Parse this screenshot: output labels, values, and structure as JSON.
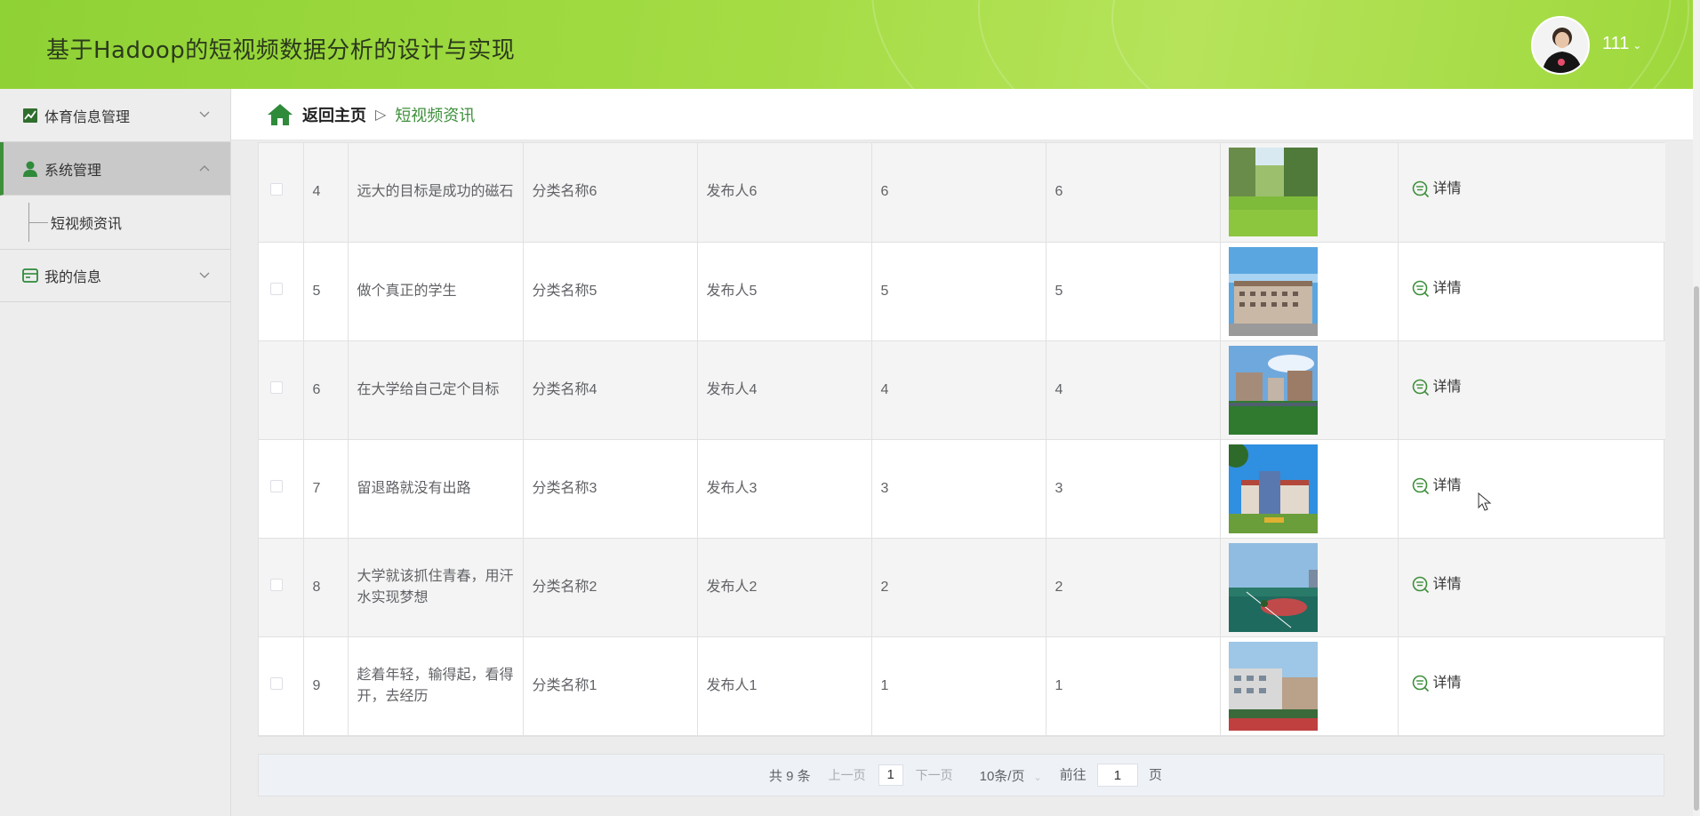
{
  "header": {
    "title": "基于Hadoop的短视频数据分析的设计与实现",
    "user": "111"
  },
  "sidebar": {
    "items": [
      {
        "label": "体育信息管理",
        "icon": "chart-icon"
      },
      {
        "label": "系统管理",
        "icon": "user-icon",
        "active": true,
        "children": [
          {
            "label": "短视频资讯"
          }
        ]
      },
      {
        "label": "我的信息",
        "icon": "card-icon"
      }
    ]
  },
  "breadcrumb": {
    "home": "返回主页",
    "separator": "▷",
    "current": "短视频资讯"
  },
  "table": {
    "detail_label": "详情",
    "rows": [
      {
        "index": "4",
        "title": "远大的目标是成功的磁石",
        "category": "分类名称6",
        "publisher": "发布人6",
        "col5": "6",
        "col6": "6",
        "image": "grass-park"
      },
      {
        "index": "5",
        "title": "做个真正的学生",
        "category": "分类名称5",
        "publisher": "发布人5",
        "col5": "5",
        "col6": "5",
        "image": "campus-building"
      },
      {
        "index": "6",
        "title": "在大学给自己定个目标",
        "category": "分类名称4",
        "publisher": "发布人4",
        "col5": "4",
        "col6": "4",
        "image": "campus-lawn"
      },
      {
        "index": "7",
        "title": "留退路就没有出路",
        "category": "分类名称3",
        "publisher": "发布人3",
        "col5": "3",
        "col6": "3",
        "image": "school-gate"
      },
      {
        "index": "8",
        "title": "大学就该抓住青春，用汗水实现梦想",
        "category": "分类名称2",
        "publisher": "发布人2",
        "col5": "2",
        "col6": "2",
        "image": "sports-court"
      },
      {
        "index": "9",
        "title": "趁着年轻，输得起，看得开，去经历",
        "category": "分类名称1",
        "publisher": "发布人1",
        "col5": "1",
        "col6": "1",
        "image": "running-track"
      }
    ]
  },
  "pagination": {
    "total": "共 9 条",
    "prev": "上一页",
    "page": "1",
    "next": "下一页",
    "page_size": "10条/页",
    "goto_prefix": "前往",
    "goto_value": "1",
    "goto_suffix": "页"
  },
  "colors": {
    "brand_green": "#3d8f3a",
    "header_green": "#a4dc44"
  }
}
